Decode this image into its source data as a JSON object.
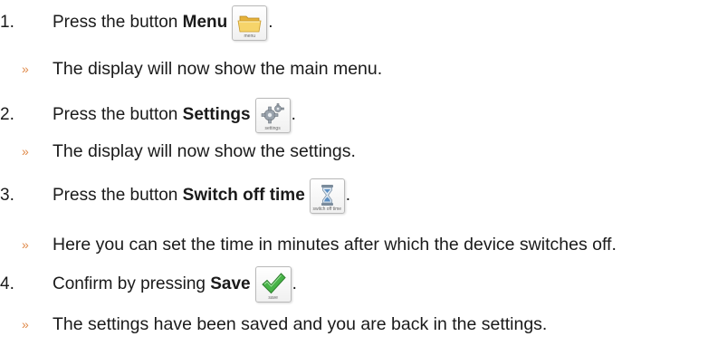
{
  "steps": [
    {
      "number": "1.",
      "prefix": "Press the button ",
      "bold": "Menu",
      "suffix": ".",
      "icon": {
        "name": "folder-icon",
        "caption": "menu"
      },
      "result": "The display will now show the main menu."
    },
    {
      "number": "2.",
      "prefix": "Press the button ",
      "bold": "Settings",
      "suffix": ".",
      "icon": {
        "name": "gears-icon",
        "caption": "settings"
      },
      "result": "The display will now show the settings."
    },
    {
      "number": "3.",
      "prefix": "Press the button ",
      "bold": "Switch off time",
      "suffix": ".",
      "icon": {
        "name": "hourglass-icon",
        "caption": "switch off time"
      },
      "result": "Here you can set the time in minutes after which the device switches off."
    },
    {
      "number": "4.",
      "prefix": "Confirm by pressing ",
      "bold": "Save",
      "suffix": ".",
      "icon": {
        "name": "checkmark-icon",
        "caption": "save"
      },
      "result": "The settings have been saved and you are back in the settings."
    }
  ],
  "result_marker": "»",
  "colors": {
    "marker": "#e08a4a",
    "check": "#3aa63a",
    "folder": "#f2c94c"
  }
}
